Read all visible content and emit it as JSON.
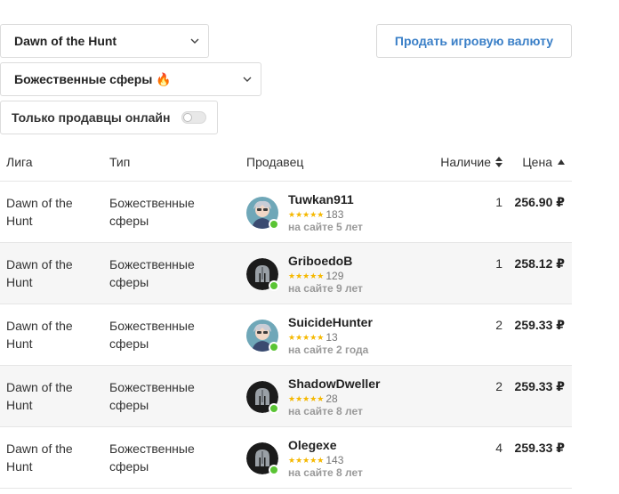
{
  "filters": {
    "league_select": {
      "value": "Dawn of the Hunt"
    },
    "type_select": {
      "value": "Божественные сферы",
      "emoji": "🔥"
    },
    "online_only": {
      "label": "Только продавцы онлайн",
      "enabled": false
    }
  },
  "sell_button": {
    "label": "Продать игровую валюту"
  },
  "table": {
    "headers": {
      "league": "Лига",
      "type": "Тип",
      "seller": "Продавец",
      "availability": "Наличие",
      "price": "Цена"
    },
    "rows": [
      {
        "league": "Dawn of the Hunt",
        "type": "Божественные сферы",
        "seller": "Tuwkan911",
        "reviews": "183",
        "since": "на сайте 5 лет",
        "avatar": "anime-avatar",
        "availability": "1",
        "price": "256.90 ₽"
      },
      {
        "league": "Dawn of the Hunt",
        "type": "Божественные сферы",
        "seller": "GriboedoB",
        "reviews": "129",
        "since": "на сайте 9 лет",
        "avatar": "helmet-avatar",
        "availability": "1",
        "price": "258.12 ₽"
      },
      {
        "league": "Dawn of the Hunt",
        "type": "Божественные сферы",
        "seller": "SuicideHunter",
        "reviews": "13",
        "since": "на сайте 2 года",
        "avatar": "anime-avatar",
        "availability": "2",
        "price": "259.33 ₽"
      },
      {
        "league": "Dawn of the Hunt",
        "type": "Божественные сферы",
        "seller": "ShadowDweller",
        "reviews": "28",
        "since": "на сайте 8 лет",
        "avatar": "helmet-avatar",
        "availability": "2",
        "price": "259.33 ₽"
      },
      {
        "league": "Dawn of the Hunt",
        "type": "Божественные сферы",
        "seller": "Olegexe",
        "reviews": "143",
        "since": "на сайте 8 лет",
        "avatar": "helmet-avatar",
        "availability": "4",
        "price": "259.33 ₽"
      }
    ]
  },
  "colors": {
    "accent_link": "#3a7fc7",
    "star": "#f5b800",
    "online_dot": "#5ac434",
    "row_alt_bg": "#f6f6f6"
  }
}
